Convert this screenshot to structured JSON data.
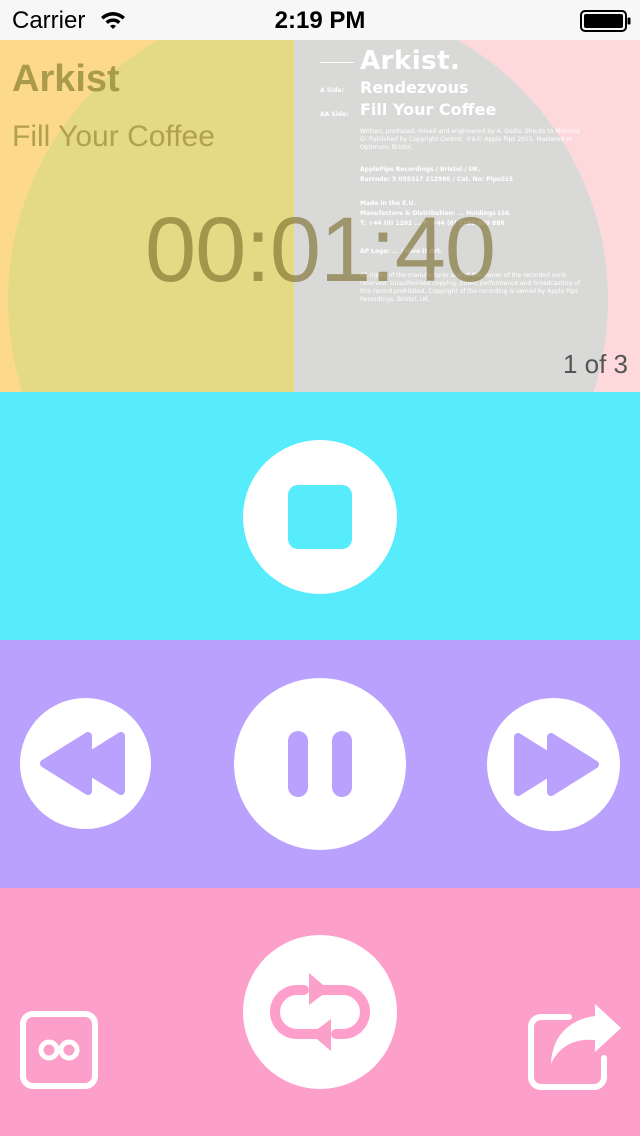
{
  "status_bar": {
    "carrier": "Carrier",
    "time": "2:19 PM",
    "icons": [
      "wifi-icon",
      "battery-icon"
    ]
  },
  "sleeve": {
    "logo": "Arkist.",
    "a_side_label": "A Side:",
    "a_side_title": "Rendezvous",
    "aa_side_label": "AA Side:",
    "aa_side_title": "Fill Your Coffee",
    "credits": "Written, produced, mixed and engineered by A. Gozla. Shouts to Momma G! Published by Copyright Control. ℗&© Apple Pips 2015. Mastered at Optimum, Bristol.",
    "label_line": "ApplePips Recordings / Bristol / UK.",
    "barcode": "Barcode: 5 055317 212986 / Cat. No: Pips015",
    "made_in": "Made in the E.U.",
    "manufacture": "Manufacture & Distribution: ... Holdings Ltd.",
    "phone": "T: +44 (0) 1202 ... F: +44 (0) 1202 890 886",
    "logo_credit": "AP Logo: ... / Give It Art.",
    "rights": "All rights of the manufacturer and of the owner of the recorded work reserved. Unauthorised copying, public performance and broadcasting of this record prohibited. Copyright of the recording is owned by Apple Pips Recordings, Bristol, UK."
  },
  "track": {
    "artist": "Arkist",
    "title": "Fill Your Coffee",
    "elapsed": "00:01:40",
    "position": "1 of 3"
  },
  "controls": {
    "stop": "stop-icon",
    "rewind": "rewind-icon",
    "pause": "pause-icon",
    "fast_forward": "fast-forward-icon",
    "repeat": "repeat-icon",
    "loop": "infinity-icon",
    "share": "share-icon"
  },
  "colors": {
    "stop_band": "#56ecfc",
    "transport_band": "#b9a1fd",
    "bottom_band": "#fd9fcb"
  }
}
